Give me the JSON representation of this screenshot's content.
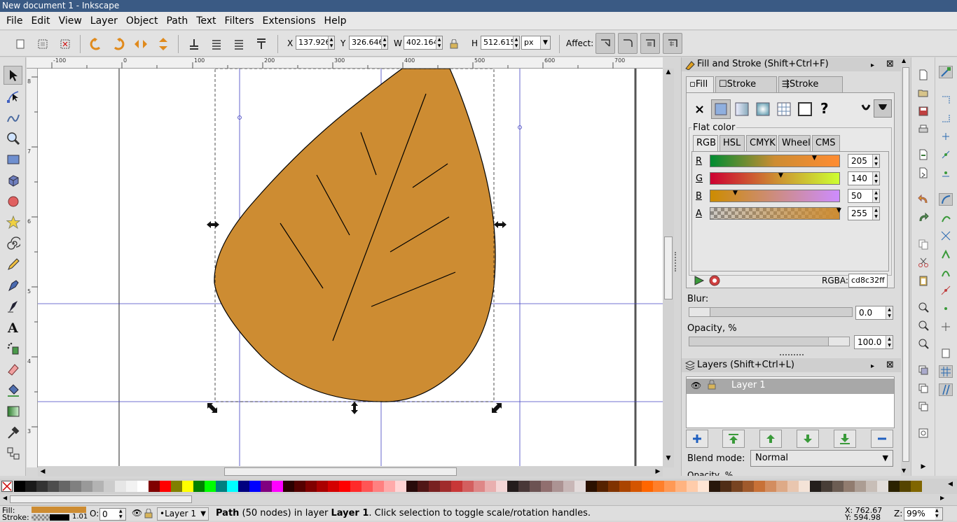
{
  "window": {
    "title": "New document 1 - Inkscape"
  },
  "menu": [
    "File",
    "Edit",
    "View",
    "Layer",
    "Object",
    "Path",
    "Text",
    "Filters",
    "Extensions",
    "Help"
  ],
  "toolbar": {
    "x_label": "X",
    "x_value": "137.926",
    "y_label": "Y",
    "y_value": "326.646",
    "w_label": "W",
    "w_value": "402.164",
    "h_label": "H",
    "h_value": "512.615",
    "unit": "px",
    "affect_label": "Affect:"
  },
  "hruler_ticks": [
    "-100",
    "0",
    "100",
    "200",
    "300",
    "400",
    "500",
    "600",
    "700"
  ],
  "vruler_ticks": [
    "8",
    "7",
    "6",
    "5",
    "4",
    "3"
  ],
  "fill_stroke": {
    "title": "Fill and Stroke (Shift+Ctrl+F)",
    "tabs": [
      "Fill",
      "Stroke paint",
      "Stroke style"
    ],
    "paint_none": "×",
    "paint_unset": "?",
    "flat_color_label": "Flat color",
    "color_tabs": [
      "RGB",
      "HSL",
      "CMYK",
      "Wheel",
      "CMS"
    ],
    "channels": [
      {
        "label": "R",
        "value": "205"
      },
      {
        "label": "G",
        "value": "140"
      },
      {
        "label": "B",
        "value": "50"
      },
      {
        "label": "A",
        "value": "255"
      }
    ],
    "rgba_label": "RGBA:",
    "rgba_value": "cd8c32ff",
    "blur_label": "Blur:",
    "blur_value": "0.0",
    "opacity_label": "Opacity, %",
    "opacity_value": "100.0"
  },
  "layers": {
    "title": "Layers (Shift+Ctrl+L)",
    "layer_name": "Layer 1",
    "blend_label": "Blend mode:",
    "blend_value": "Normal",
    "opacity_cut": "Opacity, %"
  },
  "status": {
    "fill_label": "Fill:",
    "stroke_label": "Stroke:",
    "stroke_width": "1.01",
    "o_label": "O:",
    "o_value": "0",
    "layer_select": "•Layer 1",
    "msg_bold": "Path",
    "msg1": " (50 nodes) in layer ",
    "msg_layer": "Layer 1",
    "msg2": ". Click selection to toggle scale/rotation handles.",
    "x_readout": "X: 762.67",
    "y_readout": "Y: 594.98",
    "z_label": "Z:",
    "zoom": "99%"
  },
  "colors": {
    "leaf_fill": "#cd8c32",
    "guide": "#4040c0",
    "titlebar": "#3a5a84"
  }
}
